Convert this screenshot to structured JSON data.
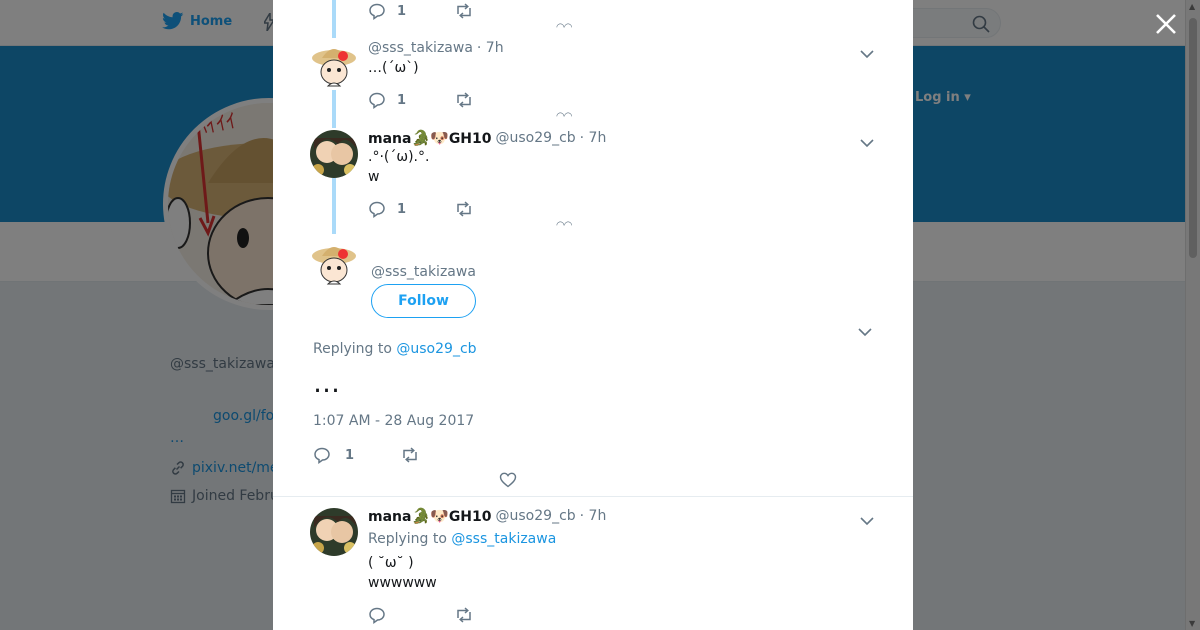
{
  "nav": {
    "home_label": "Home",
    "login_label": "Log in ▾"
  },
  "profile": {
    "name": "",
    "handle": "@sss_takizawa",
    "bio_link": "goo.gl/fo",
    "bio_more": "…",
    "website": "pixiv.net/me",
    "joined": "Joined Febru"
  },
  "thread": [
    {
      "reply_count": "1"
    },
    {
      "handle": "@sss_takizawa",
      "time": "· 7h",
      "text": "…(´ω`)",
      "reply_count": "1"
    },
    {
      "fullname": "mana",
      "emoji": "🐊🐶",
      "fullname_suffix": "GH10",
      "handle": "@uso29_cb",
      "time": "· 7h",
      "text_line1": ".°·(´ω).°.",
      "text_line2": "w",
      "reply_count": "1"
    }
  ],
  "focused": {
    "handle": "@sss_takizawa",
    "follow_label": "Follow",
    "replying_prefix": "Replying to",
    "replying_to": "@uso29_cb",
    "text": "…",
    "timestamp": "1:07 AM - 28 Aug 2017",
    "reply_count": "1"
  },
  "reply": {
    "fullname": "mana",
    "emoji": "🐊🐶",
    "fullname_suffix": "GH10",
    "handle": "@uso29_cb",
    "time": "· 7h",
    "replying_prefix": "Replying to",
    "replying_to": "@sss_takizawa",
    "text_line1": "( ˘ω˘ )",
    "text_line2": "wwwwww"
  },
  "colors": {
    "twitter_blue": "#1da1f2",
    "banner": "#1b8ccb",
    "thread_line": "#aadaf9",
    "text_secondary": "#657786"
  }
}
